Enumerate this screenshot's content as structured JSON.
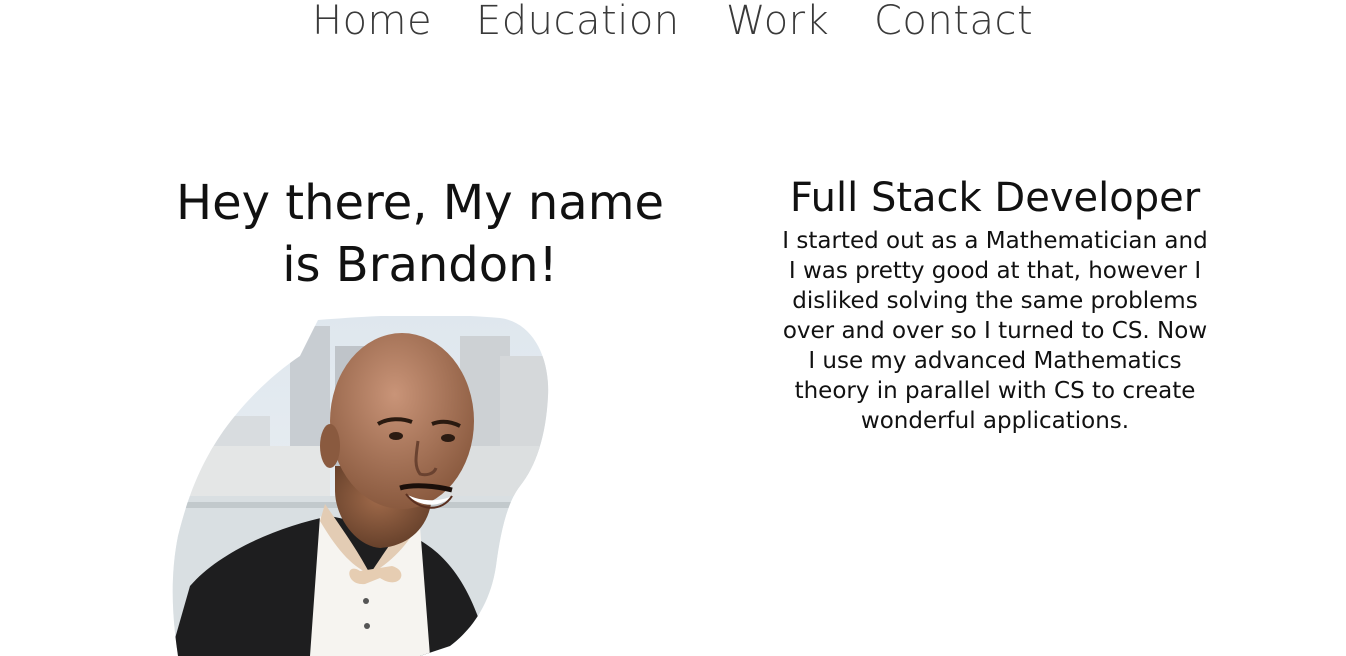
{
  "nav": {
    "items": [
      {
        "label": "Home"
      },
      {
        "label": "Education"
      },
      {
        "label": "Work"
      },
      {
        "label": "Contact"
      }
    ]
  },
  "hero": {
    "title_line1": "Hey there, My name",
    "title_line2": "is Brandon!"
  },
  "about": {
    "role": "Full Stack Developer",
    "bio": "I started out as a Mathematician and I was pretty good at that, however I disliked solving the same problems over and over so I turned to CS. Now I use my advanced Mathematics theory in parallel with CS to create wonderful applications."
  },
  "colors": {
    "nav_text": "#3a3a3a",
    "body_text": "#111111",
    "background": "#ffffff"
  }
}
